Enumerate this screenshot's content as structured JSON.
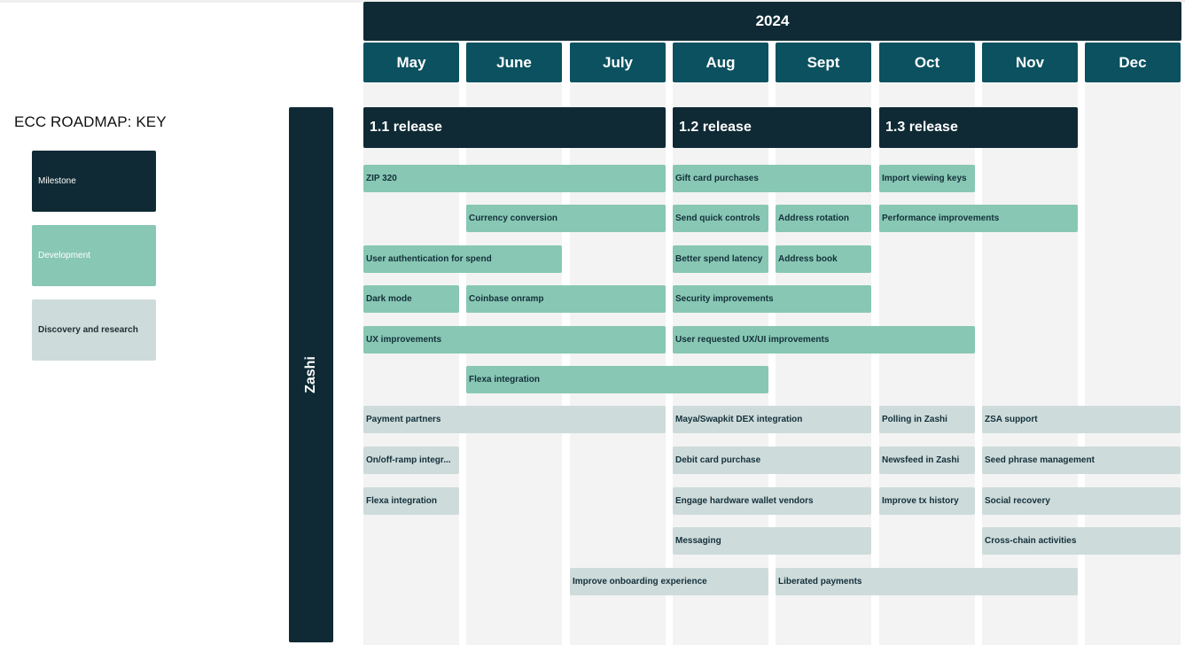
{
  "key": {
    "title": "ECC ROADMAP: KEY",
    "items": [
      {
        "label": "Milestone",
        "type": "milestone"
      },
      {
        "label": "Development",
        "type": "dev"
      },
      {
        "label": "Discovery and research",
        "type": "disc"
      }
    ]
  },
  "colors": {
    "milestone": "#0f2a35",
    "month_header": "#0b5160",
    "development": "#88c7b4",
    "discovery": "#cedbdb",
    "column_background": "#f3f3f3"
  },
  "timeline": {
    "year": "2024",
    "months": [
      "May",
      "June",
      "July",
      "Aug",
      "Sept",
      "Oct",
      "Nov",
      "Dec"
    ]
  },
  "lane": {
    "label": "Zashi"
  },
  "milestones": [
    {
      "label": "1.1 release",
      "start": "May",
      "end": "July"
    },
    {
      "label": "1.2 release",
      "start": "Aug",
      "end": "Sept"
    },
    {
      "label": "1.3 release",
      "start": "Oct",
      "end": "Nov"
    }
  ],
  "development": [
    {
      "label": "ZIP 320",
      "row": 0,
      "start": "May",
      "end": "July"
    },
    {
      "label": "Gift card purchases",
      "row": 0,
      "start": "Aug",
      "end": "Sept"
    },
    {
      "label": "Import viewing keys",
      "row": 0,
      "start": "Oct",
      "end": "Oct"
    },
    {
      "label": "Currency conversion",
      "row": 1,
      "start": "June",
      "end": "July"
    },
    {
      "label": "Send quick controls",
      "row": 1,
      "start": "Aug",
      "end": "Aug"
    },
    {
      "label": "Address rotation",
      "row": 1,
      "start": "Sept",
      "end": "Sept"
    },
    {
      "label": "Performance improvements",
      "row": 1,
      "start": "Oct",
      "end": "Nov"
    },
    {
      "label": "User authentication for spend",
      "row": 2,
      "start": "May",
      "end": "June"
    },
    {
      "label": "Better spend latency",
      "row": 2,
      "start": "Aug",
      "end": "Aug"
    },
    {
      "label": "Address book",
      "row": 2,
      "start": "Sept",
      "end": "Sept"
    },
    {
      "label": "Dark mode",
      "row": 3,
      "start": "May",
      "end": "May"
    },
    {
      "label": "Coinbase onramp",
      "row": 3,
      "start": "June",
      "end": "July"
    },
    {
      "label": "Security improvements",
      "row": 3,
      "start": "Aug",
      "end": "Sept"
    },
    {
      "label": "UX improvements",
      "row": 4,
      "start": "May",
      "end": "July"
    },
    {
      "label": "User requested UX/UI improvements",
      "row": 4,
      "start": "Aug",
      "end": "Oct"
    },
    {
      "label": "Flexa integration",
      "row": 5,
      "start": "June",
      "end": "Aug"
    }
  ],
  "discovery": [
    {
      "label": "Payment partners",
      "row": 0,
      "start": "May",
      "end": "July"
    },
    {
      "label": "Maya/Swapkit DEX integration",
      "row": 0,
      "start": "Aug",
      "end": "Sept"
    },
    {
      "label": "Polling in Zashi",
      "row": 0,
      "start": "Oct",
      "end": "Oct"
    },
    {
      "label": "ZSA support",
      "row": 0,
      "start": "Nov",
      "end": "Dec"
    },
    {
      "label": "On/off-ramp integr...",
      "row": 1,
      "start": "May",
      "end": "May"
    },
    {
      "label": "Debit card purchase",
      "row": 1,
      "start": "Aug",
      "end": "Sept"
    },
    {
      "label": "Newsfeed in Zashi",
      "row": 1,
      "start": "Oct",
      "end": "Oct"
    },
    {
      "label": "Seed phrase management",
      "row": 1,
      "start": "Nov",
      "end": "Dec"
    },
    {
      "label": "Flexa integration",
      "row": 2,
      "start": "May",
      "end": "May"
    },
    {
      "label": "Engage hardware wallet vendors",
      "row": 2,
      "start": "Aug",
      "end": "Sept"
    },
    {
      "label": "Improve tx history",
      "row": 2,
      "start": "Oct",
      "end": "Oct"
    },
    {
      "label": "Social recovery",
      "row": 2,
      "start": "Nov",
      "end": "Dec"
    },
    {
      "label": "Messaging",
      "row": 3,
      "start": "Aug",
      "end": "Sept"
    },
    {
      "label": "Cross-chain activities",
      "row": 3,
      "start": "Nov",
      "end": "Dec"
    },
    {
      "label": "Improve onboarding experience",
      "row": 4,
      "start": "July",
      "end": "Aug"
    },
    {
      "label": "Liberated payments",
      "row": 4,
      "start": "Sept",
      "end": "Nov"
    }
  ]
}
